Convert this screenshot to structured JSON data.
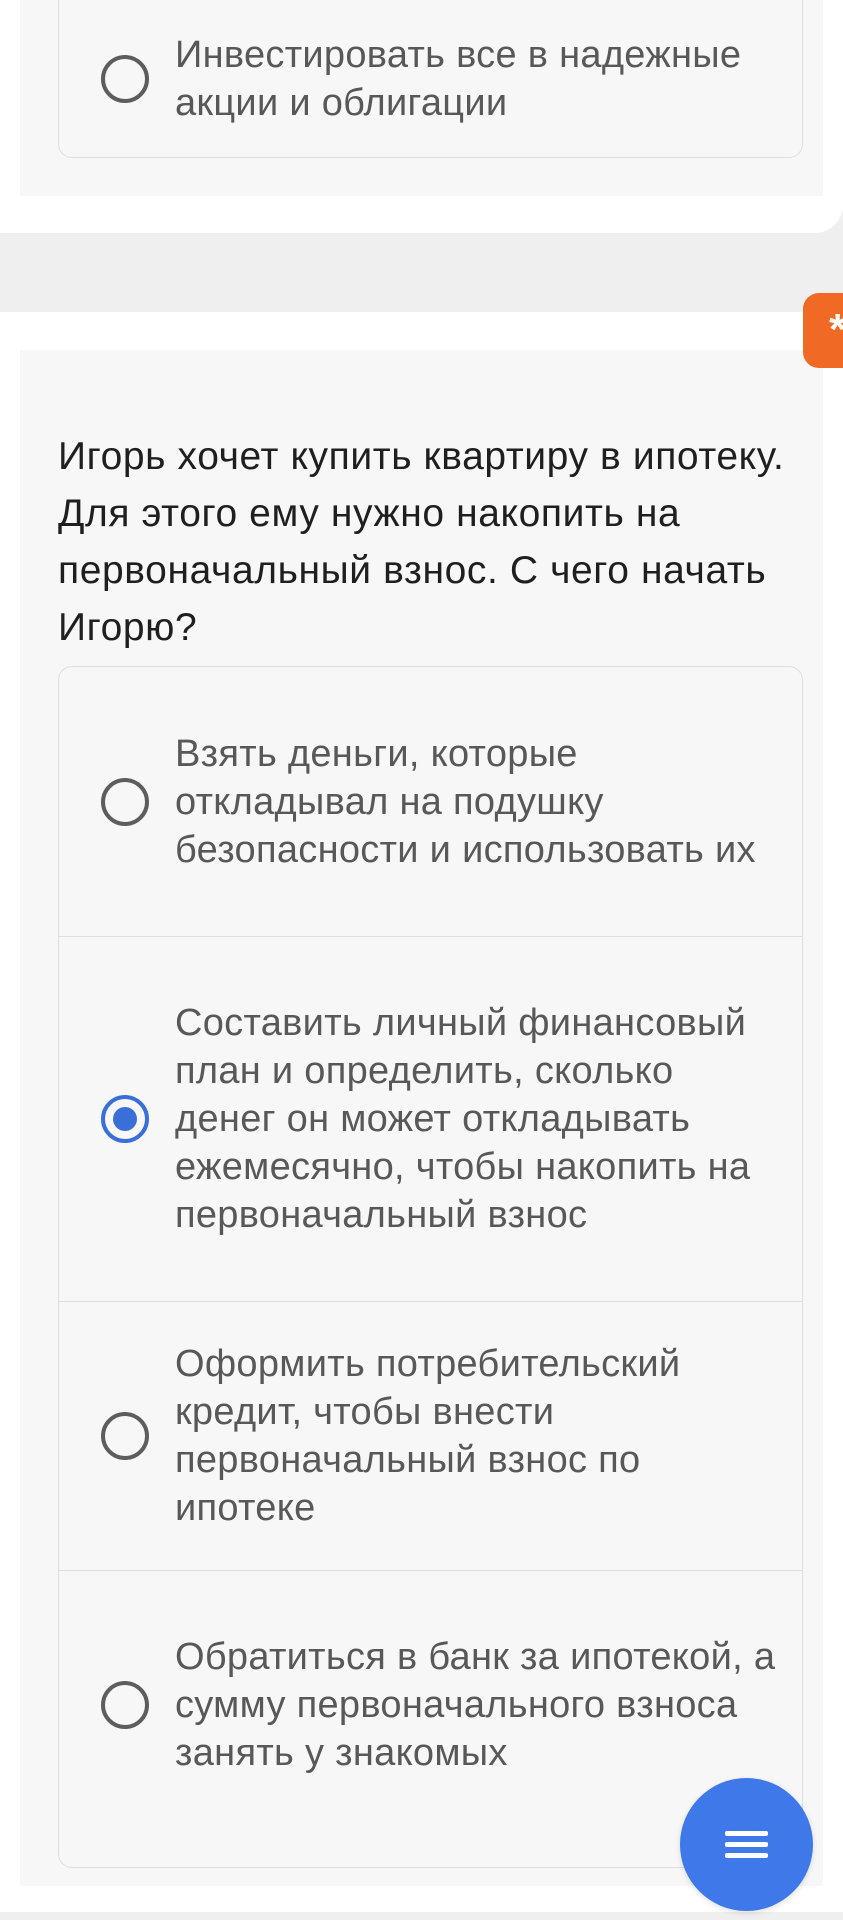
{
  "previous_question": {
    "options": [
      {
        "label": "Инвестировать все в надежные акции и облигации",
        "selected": false
      }
    ]
  },
  "question": {
    "text": "Игорь хочет купить квартиру в ипотеку. Для этого ему нужно накопить на первоначальный взнос. С чего начать Игорю?",
    "options": [
      {
        "label": "Взять деньги, которые откладывал на подушку безопасности и использовать их",
        "selected": false
      },
      {
        "label": "Составить личный финансовый план и определить, сколько денег он может откладывать ежемесячно, чтобы накопить на первоначальный взнос",
        "selected": true
      },
      {
        "label": "Оформить потребительский кредит, чтобы внести первоначальный взнос по ипотеке",
        "selected": false
      },
      {
        "label": "Обратиться в банк за ипотекой, а сумму первоначального взноса занять у знакомых",
        "selected": false
      }
    ]
  },
  "side_tab": {
    "glyph": "*"
  },
  "fab": {
    "icon": "menu-icon"
  },
  "colors": {
    "accent": "#3f78e8",
    "radio_checked": "#3a6fd8",
    "side_tab": "#f06a25"
  }
}
